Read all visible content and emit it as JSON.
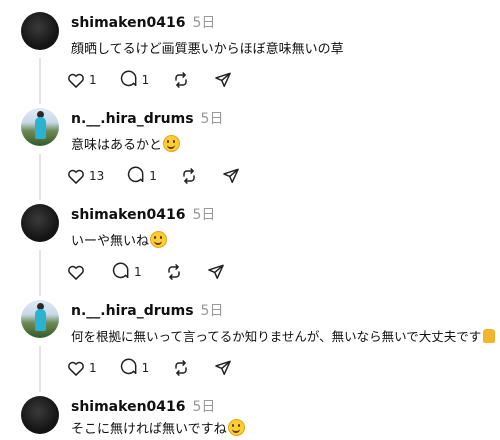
{
  "posts": [
    {
      "username": "shimaken0416",
      "time": "5日",
      "text": "顔晒してるけど画質悪いからほぼ意味無いの草",
      "emoji": "",
      "likes": "1",
      "replies": "1"
    },
    {
      "username": "n.__.hira_drums",
      "time": "5日",
      "text": "意味はあるかと",
      "emoji": "grinning-sweat-emoji",
      "likes": "13",
      "replies": "1"
    },
    {
      "username": "shimaken0416",
      "time": "5日",
      "text": "いーや無いね",
      "emoji": "smiling-emoji",
      "likes": "",
      "replies": "1"
    },
    {
      "username": "n.__.hira_drums",
      "time": "5日",
      "text": "何を根拠に無いって言ってるか知りませんが、無いなら無いで大丈夫です",
      "emoji": "thumbs-up-emoji",
      "likes": "1",
      "replies": "1"
    },
    {
      "username": "shimaken0416",
      "time": "5日",
      "text": "そこに無ければ無いですね",
      "emoji": "smiling-emoji",
      "likes": "",
      "replies": ""
    }
  ]
}
